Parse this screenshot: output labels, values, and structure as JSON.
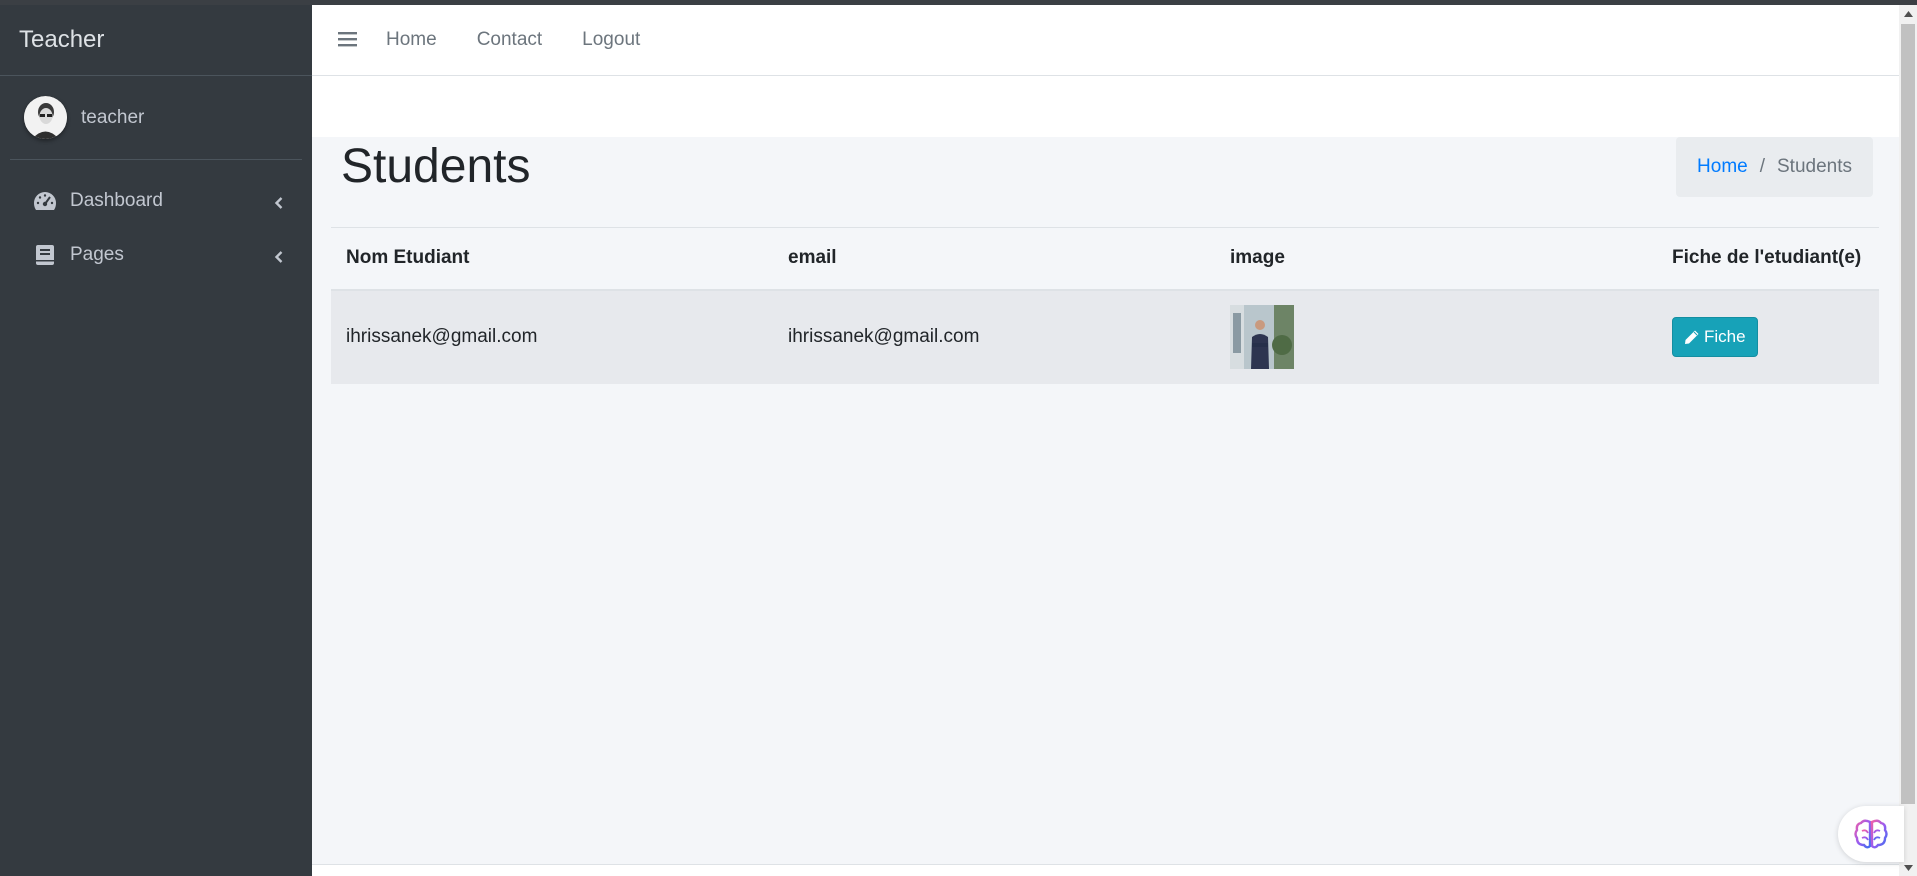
{
  "sidebar": {
    "brand": "Teacher",
    "user_name": "teacher",
    "items": [
      {
        "label": "Dashboard",
        "icon": "tachometer-icon"
      },
      {
        "label": "Pages",
        "icon": "book-icon"
      }
    ]
  },
  "navbar": {
    "links": [
      "Home",
      "Contact",
      "Logout"
    ]
  },
  "content": {
    "title": "Students",
    "breadcrumb": {
      "home": "Home",
      "separator": "/",
      "current": "Students"
    }
  },
  "table": {
    "headers": [
      "Nom Etudiant",
      "email",
      "image",
      "Fiche de l'etudiant(e)"
    ],
    "rows": [
      {
        "name": "ihrissanek@gmail.com",
        "email": "ihrissanek@gmail.com",
        "image": "student-photo",
        "action_label": "Fiche"
      }
    ]
  },
  "colors": {
    "sidebar_bg": "#343a40",
    "link_blue": "#007bff",
    "button_info": "#17a2b8"
  }
}
